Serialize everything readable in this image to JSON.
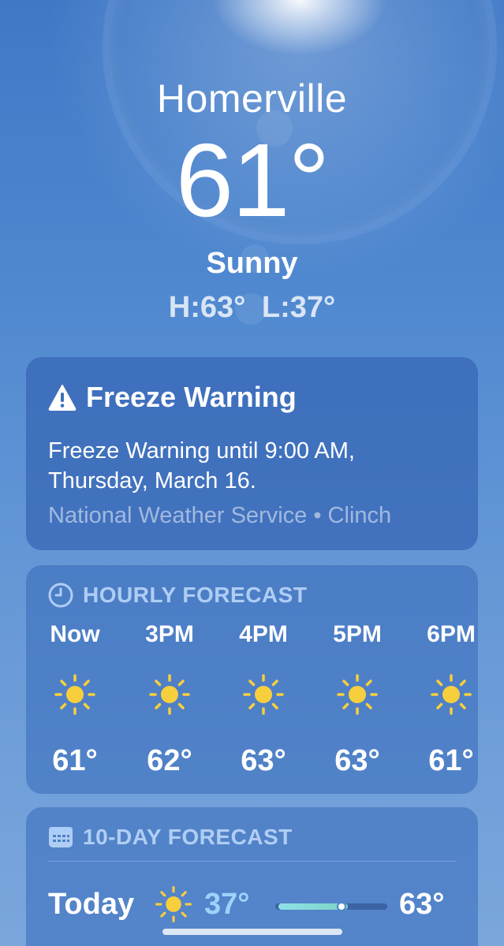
{
  "location": {
    "city": "Homerville",
    "temperature": "61°",
    "condition": "Sunny",
    "high_low": "H:63°  L:37°"
  },
  "alert": {
    "icon": "warning-triangle-icon",
    "title": "Freeze Warning",
    "body": "Freeze Warning until 9:00 AM, Thursday, March 16.",
    "source": "National Weather Service • Clinch"
  },
  "hourly": {
    "icon": "clock-icon",
    "title": "HOURLY FORECAST",
    "items": [
      {
        "time": "Now",
        "icon": "sun-icon",
        "temp": "61°"
      },
      {
        "time": "3PM",
        "icon": "sun-icon",
        "temp": "62°"
      },
      {
        "time": "4PM",
        "icon": "sun-icon",
        "temp": "63°"
      },
      {
        "time": "5PM",
        "icon": "sun-icon",
        "temp": "63°"
      },
      {
        "time": "6PM",
        "icon": "sun-icon",
        "temp": "61°"
      }
    ]
  },
  "ten_day": {
    "icon": "calendar-icon",
    "title": "10-DAY FORECAST",
    "days": [
      {
        "day": "Today",
        "icon": "sun-icon",
        "low": "37°",
        "high": "63°",
        "current_position": 0.6
      }
    ]
  },
  "colors": {
    "sun": "#f7cf3d",
    "low_temp": "#a0d7ff",
    "range_fill": "#8fe0e6"
  }
}
